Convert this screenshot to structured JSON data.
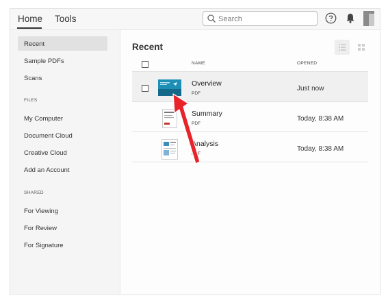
{
  "topbar": {
    "tabs": [
      {
        "label": "Home"
      },
      {
        "label": "Tools"
      }
    ],
    "search_placeholder": "Search"
  },
  "sidebar": {
    "items": [
      {
        "label": "Recent"
      },
      {
        "label": "Sample PDFs"
      },
      {
        "label": "Scans"
      }
    ],
    "files_header": "FILES",
    "files": [
      {
        "label": "My Computer"
      },
      {
        "label": "Document Cloud"
      },
      {
        "label": "Creative Cloud"
      },
      {
        "label": "Add an Account"
      }
    ],
    "shared_header": "SHARED",
    "shared": [
      {
        "label": "For Viewing"
      },
      {
        "label": "For Review"
      },
      {
        "label": "For Signature"
      }
    ]
  },
  "main": {
    "title": "Recent",
    "columns": {
      "name": "NAME",
      "opened": "OPENED"
    },
    "rows": [
      {
        "name": "Overview",
        "type": "PDF",
        "opened": "Just now"
      },
      {
        "name": "Summary",
        "type": "PDF",
        "opened": "Today, 8:38 AM"
      },
      {
        "name": "Analysis",
        "type": "PDF",
        "opened": "Today, 8:38 AM"
      }
    ]
  },
  "icons": {
    "search": "search-icon",
    "help": "help-icon",
    "notifications": "bell-icon",
    "list_view": "list-view-icon",
    "grid_view": "grid-view-icon",
    "annotation": "red-arrow"
  },
  "colors": {
    "arrow": "#e8232a",
    "selected_row": "#f0f0f0",
    "sidebar_active": "#e1e1e1"
  }
}
